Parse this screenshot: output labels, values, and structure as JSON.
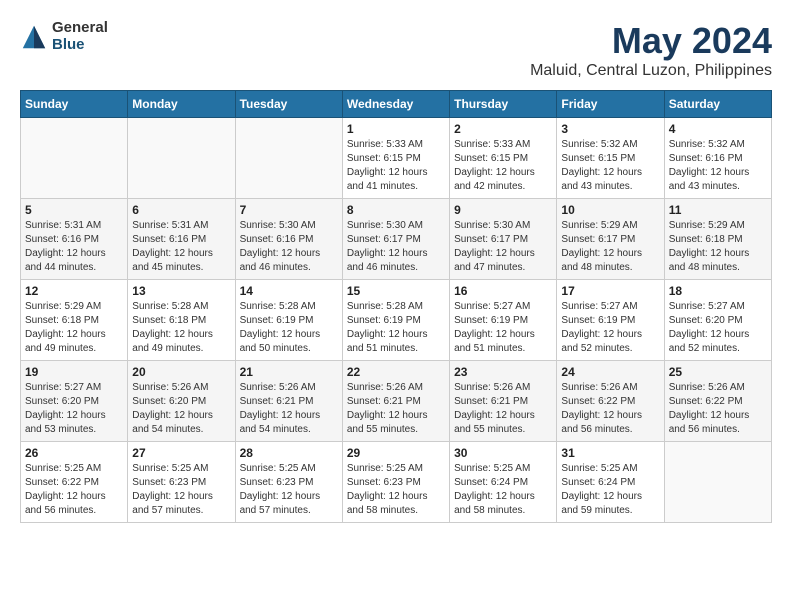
{
  "header": {
    "logo": {
      "general": "General",
      "blue": "Blue"
    },
    "title": "May 2024",
    "subtitle": "Maluid, Central Luzon, Philippines"
  },
  "calendar": {
    "days_of_week": [
      "Sunday",
      "Monday",
      "Tuesday",
      "Wednesday",
      "Thursday",
      "Friday",
      "Saturday"
    ],
    "weeks": [
      [
        {
          "day": "",
          "info": ""
        },
        {
          "day": "",
          "info": ""
        },
        {
          "day": "",
          "info": ""
        },
        {
          "day": "1",
          "info": "Sunrise: 5:33 AM\nSunset: 6:15 PM\nDaylight: 12 hours\nand 41 minutes."
        },
        {
          "day": "2",
          "info": "Sunrise: 5:33 AM\nSunset: 6:15 PM\nDaylight: 12 hours\nand 42 minutes."
        },
        {
          "day": "3",
          "info": "Sunrise: 5:32 AM\nSunset: 6:15 PM\nDaylight: 12 hours\nand 43 minutes."
        },
        {
          "day": "4",
          "info": "Sunrise: 5:32 AM\nSunset: 6:16 PM\nDaylight: 12 hours\nand 43 minutes."
        }
      ],
      [
        {
          "day": "5",
          "info": "Sunrise: 5:31 AM\nSunset: 6:16 PM\nDaylight: 12 hours\nand 44 minutes."
        },
        {
          "day": "6",
          "info": "Sunrise: 5:31 AM\nSunset: 6:16 PM\nDaylight: 12 hours\nand 45 minutes."
        },
        {
          "day": "7",
          "info": "Sunrise: 5:30 AM\nSunset: 6:16 PM\nDaylight: 12 hours\nand 46 minutes."
        },
        {
          "day": "8",
          "info": "Sunrise: 5:30 AM\nSunset: 6:17 PM\nDaylight: 12 hours\nand 46 minutes."
        },
        {
          "day": "9",
          "info": "Sunrise: 5:30 AM\nSunset: 6:17 PM\nDaylight: 12 hours\nand 47 minutes."
        },
        {
          "day": "10",
          "info": "Sunrise: 5:29 AM\nSunset: 6:17 PM\nDaylight: 12 hours\nand 48 minutes."
        },
        {
          "day": "11",
          "info": "Sunrise: 5:29 AM\nSunset: 6:18 PM\nDaylight: 12 hours\nand 48 minutes."
        }
      ],
      [
        {
          "day": "12",
          "info": "Sunrise: 5:29 AM\nSunset: 6:18 PM\nDaylight: 12 hours\nand 49 minutes."
        },
        {
          "day": "13",
          "info": "Sunrise: 5:28 AM\nSunset: 6:18 PM\nDaylight: 12 hours\nand 49 minutes."
        },
        {
          "day": "14",
          "info": "Sunrise: 5:28 AM\nSunset: 6:19 PM\nDaylight: 12 hours\nand 50 minutes."
        },
        {
          "day": "15",
          "info": "Sunrise: 5:28 AM\nSunset: 6:19 PM\nDaylight: 12 hours\nand 51 minutes."
        },
        {
          "day": "16",
          "info": "Sunrise: 5:27 AM\nSunset: 6:19 PM\nDaylight: 12 hours\nand 51 minutes."
        },
        {
          "day": "17",
          "info": "Sunrise: 5:27 AM\nSunset: 6:19 PM\nDaylight: 12 hours\nand 52 minutes."
        },
        {
          "day": "18",
          "info": "Sunrise: 5:27 AM\nSunset: 6:20 PM\nDaylight: 12 hours\nand 52 minutes."
        }
      ],
      [
        {
          "day": "19",
          "info": "Sunrise: 5:27 AM\nSunset: 6:20 PM\nDaylight: 12 hours\nand 53 minutes."
        },
        {
          "day": "20",
          "info": "Sunrise: 5:26 AM\nSunset: 6:20 PM\nDaylight: 12 hours\nand 54 minutes."
        },
        {
          "day": "21",
          "info": "Sunrise: 5:26 AM\nSunset: 6:21 PM\nDaylight: 12 hours\nand 54 minutes."
        },
        {
          "day": "22",
          "info": "Sunrise: 5:26 AM\nSunset: 6:21 PM\nDaylight: 12 hours\nand 55 minutes."
        },
        {
          "day": "23",
          "info": "Sunrise: 5:26 AM\nSunset: 6:21 PM\nDaylight: 12 hours\nand 55 minutes."
        },
        {
          "day": "24",
          "info": "Sunrise: 5:26 AM\nSunset: 6:22 PM\nDaylight: 12 hours\nand 56 minutes."
        },
        {
          "day": "25",
          "info": "Sunrise: 5:26 AM\nSunset: 6:22 PM\nDaylight: 12 hours\nand 56 minutes."
        }
      ],
      [
        {
          "day": "26",
          "info": "Sunrise: 5:25 AM\nSunset: 6:22 PM\nDaylight: 12 hours\nand 56 minutes."
        },
        {
          "day": "27",
          "info": "Sunrise: 5:25 AM\nSunset: 6:23 PM\nDaylight: 12 hours\nand 57 minutes."
        },
        {
          "day": "28",
          "info": "Sunrise: 5:25 AM\nSunset: 6:23 PM\nDaylight: 12 hours\nand 57 minutes."
        },
        {
          "day": "29",
          "info": "Sunrise: 5:25 AM\nSunset: 6:23 PM\nDaylight: 12 hours\nand 58 minutes."
        },
        {
          "day": "30",
          "info": "Sunrise: 5:25 AM\nSunset: 6:24 PM\nDaylight: 12 hours\nand 58 minutes."
        },
        {
          "day": "31",
          "info": "Sunrise: 5:25 AM\nSunset: 6:24 PM\nDaylight: 12 hours\nand 59 minutes."
        },
        {
          "day": "",
          "info": ""
        }
      ]
    ]
  }
}
